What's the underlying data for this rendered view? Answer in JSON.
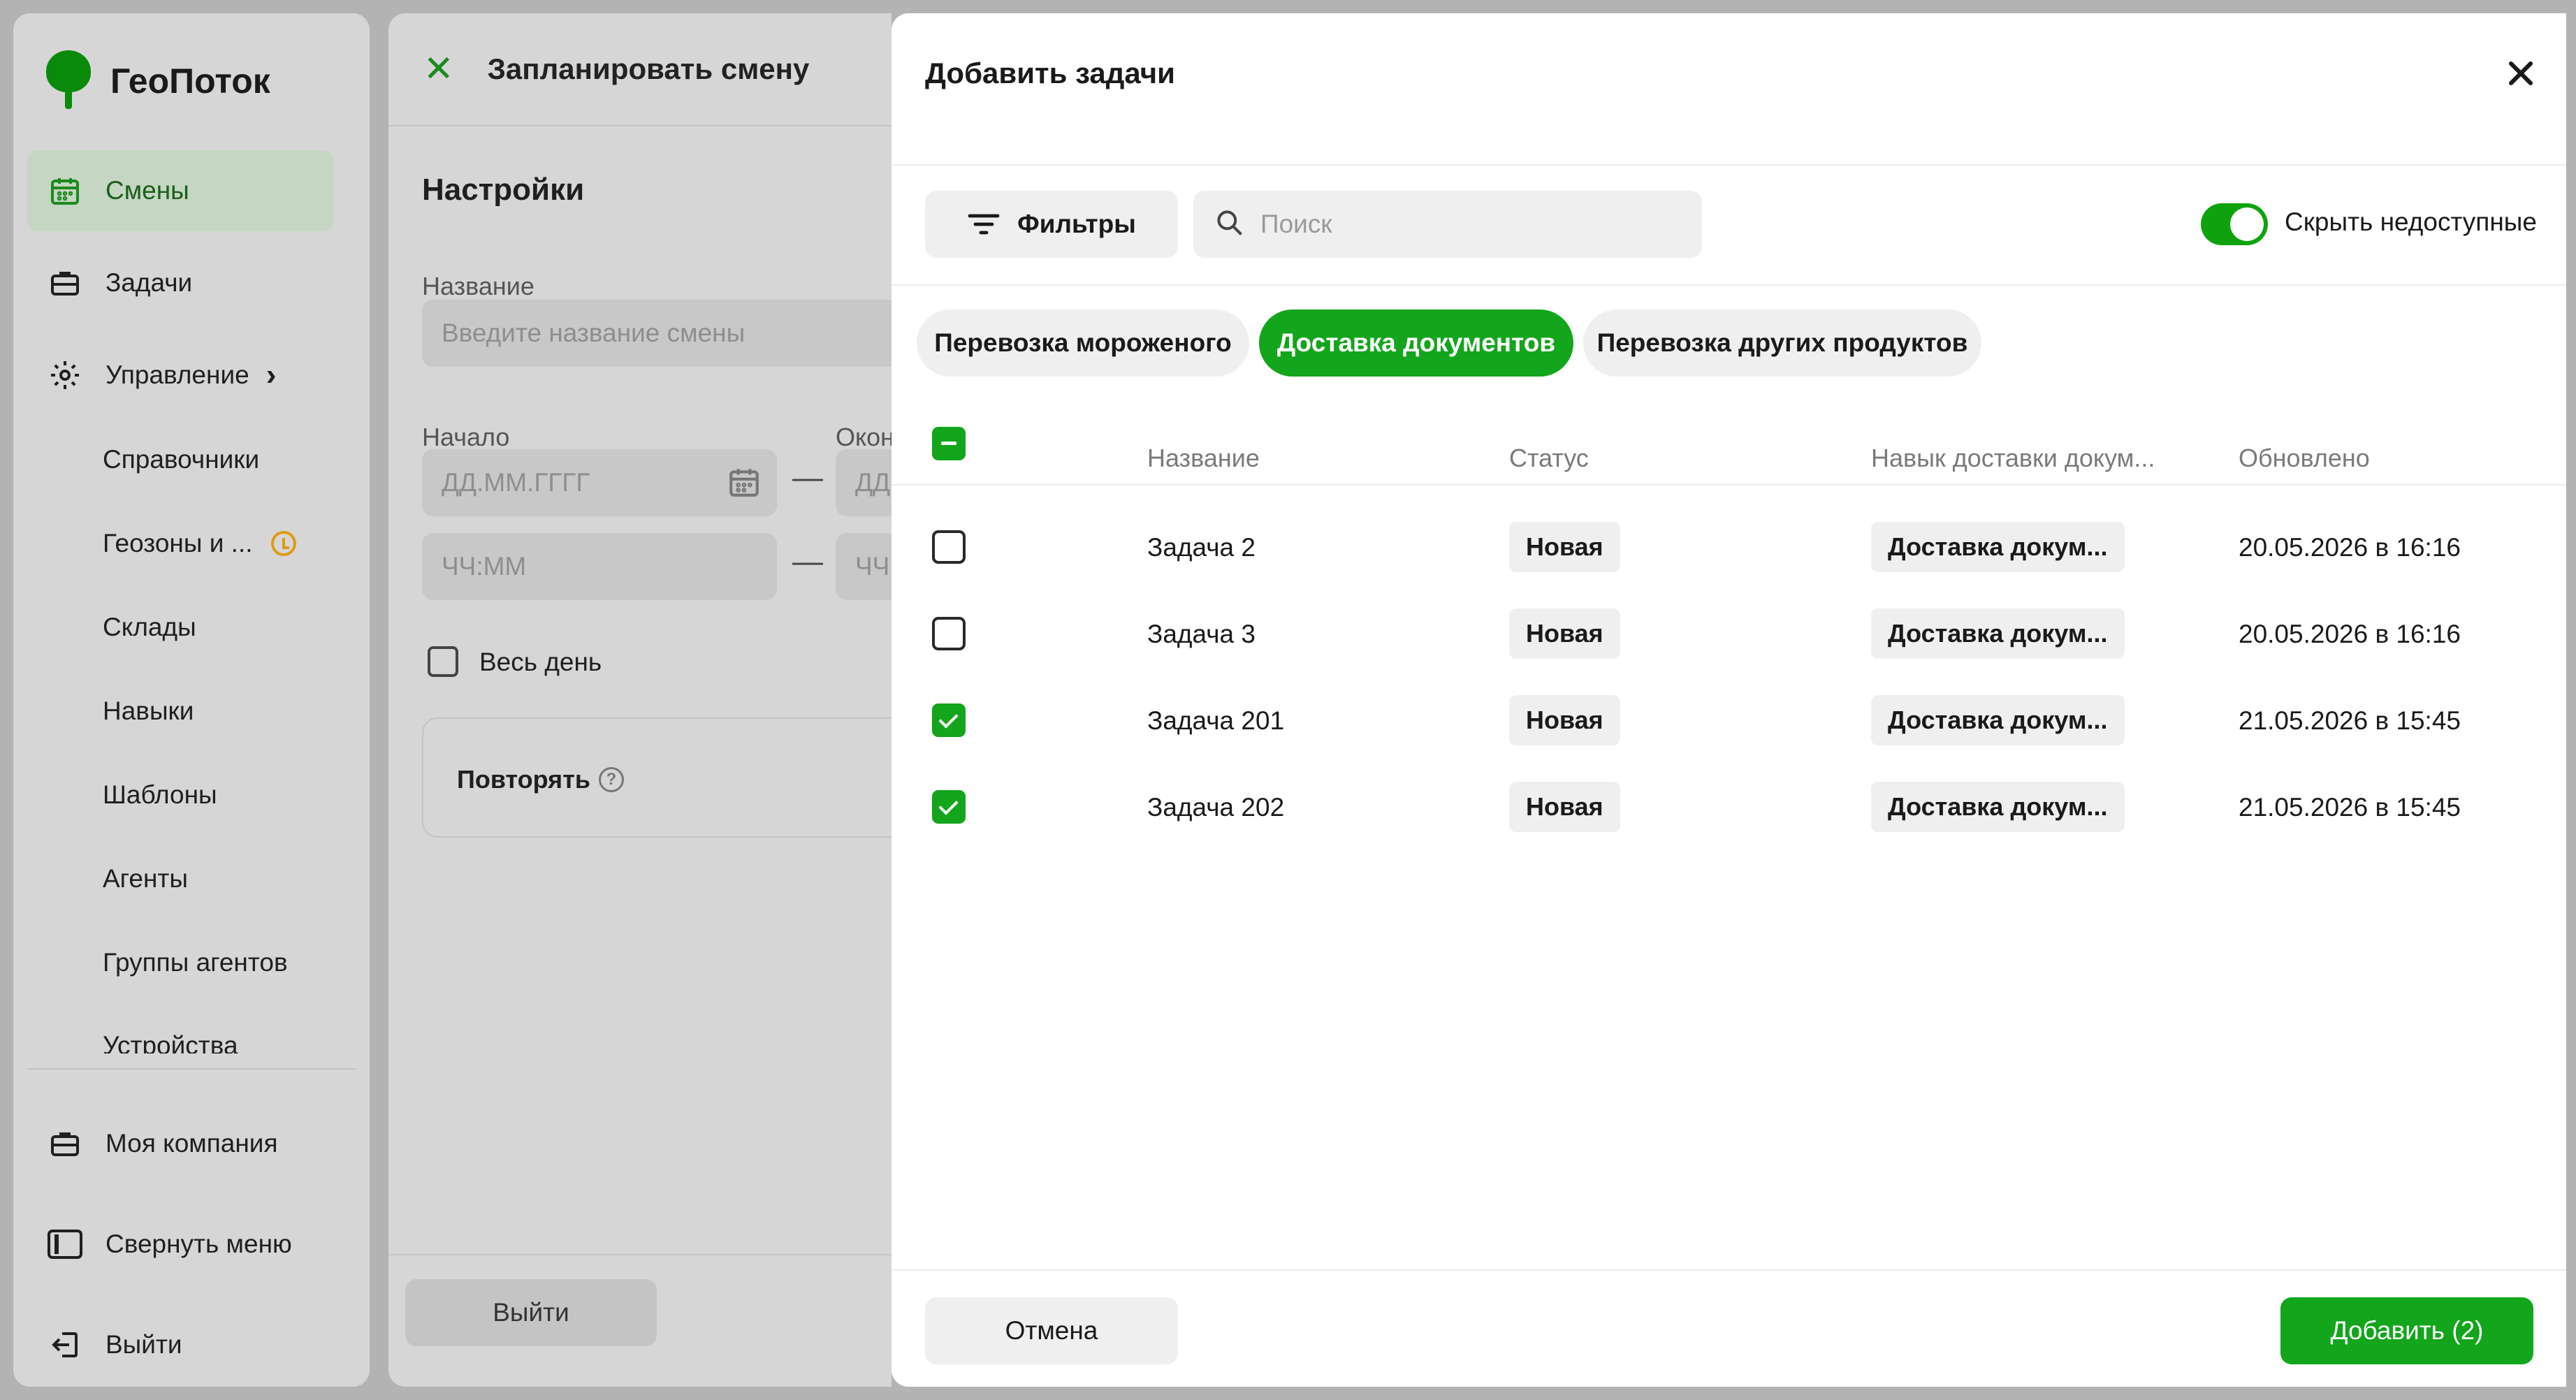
{
  "app": {
    "name": "ГеоПоток",
    "accent": "#13a51c"
  },
  "sidebar": {
    "main_items": [
      {
        "label": "Смены",
        "icon": "calendar-icon",
        "active": true
      },
      {
        "label": "Задачи",
        "icon": "briefcase-icon"
      },
      {
        "label": "Управление",
        "icon": "gear-icon"
      }
    ],
    "sub_items": [
      {
        "label": "Справочники"
      },
      {
        "label": "Геозоны и ...",
        "badge": "clock-icon"
      },
      {
        "label": "Склады"
      },
      {
        "label": "Навыки"
      },
      {
        "label": "Шаблоны"
      },
      {
        "label": "Агенты"
      },
      {
        "label": "Группы агентов"
      },
      {
        "label": "Устройства"
      }
    ],
    "bottom_items": [
      {
        "label": "Моя компания",
        "icon": "briefcase-icon"
      },
      {
        "label": "Свернуть меню",
        "icon": "collapse-icon"
      },
      {
        "label": "Выйти",
        "icon": "logout-icon"
      }
    ]
  },
  "shift_form": {
    "title": "Запланировать смену",
    "section": "Настройки",
    "name_label": "Название",
    "name_placeholder": "Введите название смены",
    "start_label": "Начало",
    "end_label": "Окон",
    "date_placeholder": "ДД.ММ.ГГГГ",
    "date_placeholder_cut": "ДД",
    "time_placeholder": "ЧЧ:ММ",
    "time_placeholder_cut": "ЧЧ",
    "all_day_label": "Весь день",
    "repeat_label": "Повторять",
    "exit_button": "Выйти"
  },
  "modal": {
    "title": "Добавить задачи",
    "filters_button": "Фильтры",
    "search_placeholder": "Поиск",
    "hide_unavailable_label": "Скрыть недоступные",
    "hide_unavailable_on": true,
    "chips": [
      {
        "label": "Перевозка мороженого",
        "active": false
      },
      {
        "label": "Доставка документов",
        "active": true
      },
      {
        "label": "Перевозка других продуктов",
        "active": false
      }
    ],
    "columns": [
      "Название",
      "Статус",
      "Навык доставки докум...",
      "Обновлено"
    ],
    "rows": [
      {
        "name": "Задача 2",
        "status": "Новая",
        "skill": "Доставка докум...",
        "updated": "20.05.2026 в 16:16",
        "checked": false
      },
      {
        "name": "Задача 3",
        "status": "Новая",
        "skill": "Доставка докум...",
        "updated": "20.05.2026 в 16:16",
        "checked": false
      },
      {
        "name": "Задача 201",
        "status": "Новая",
        "skill": "Доставка докум...",
        "updated": "21.05.2026 в 15:45",
        "checked": true
      },
      {
        "name": "Задача 202",
        "status": "Новая",
        "skill": "Доставка докум...",
        "updated": "21.05.2026 в 15:45",
        "checked": true
      }
    ],
    "cancel_button": "Отмена",
    "add_button": "Добавить (2)"
  }
}
